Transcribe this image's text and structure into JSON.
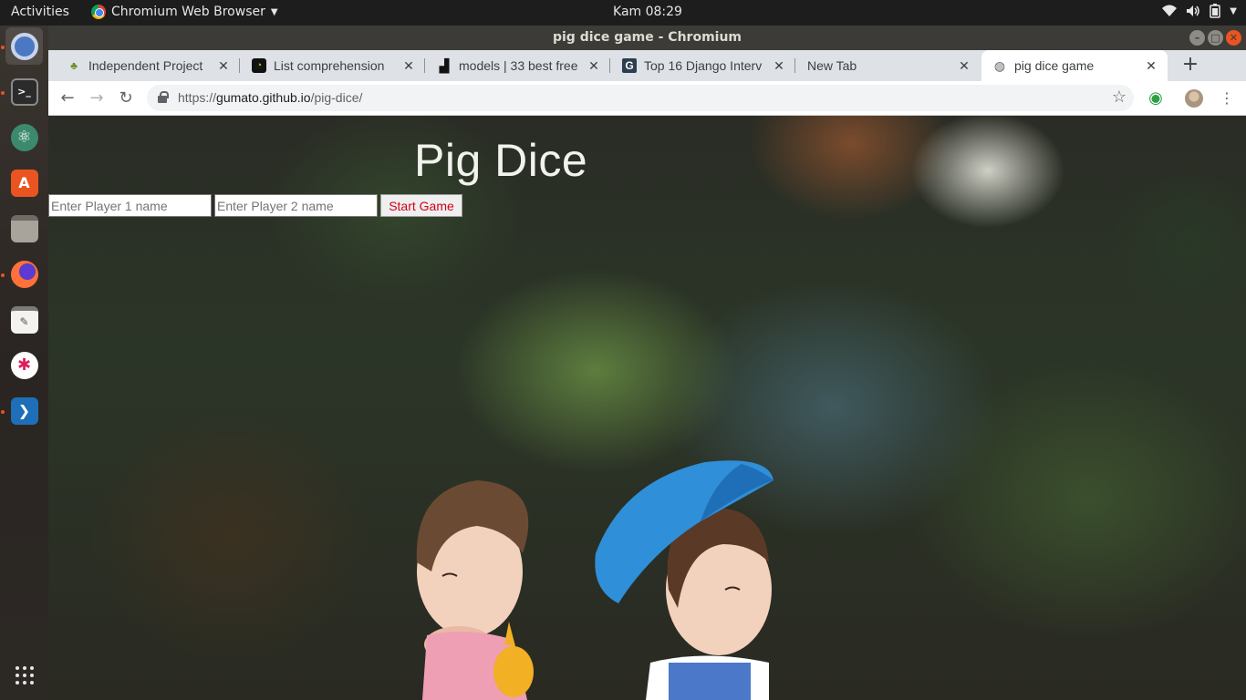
{
  "topbar": {
    "activities": "Activities",
    "app_name": "Chromium Web Browser",
    "clock": "Kam 08:29",
    "tray_icons": [
      "wifi-icon",
      "volume-icon",
      "battery-icon",
      "menu-caret-icon"
    ]
  },
  "dock": {
    "items": [
      {
        "name": "chromium",
        "icon": "chromium-icon",
        "active": true
      },
      {
        "name": "terminal",
        "icon": "terminal-icon"
      },
      {
        "name": "atom",
        "icon": "atom-icon"
      },
      {
        "name": "software",
        "icon": "software-center-icon"
      },
      {
        "name": "files",
        "icon": "files-icon"
      },
      {
        "name": "firefox",
        "icon": "firefox-icon"
      },
      {
        "name": "text-editor",
        "icon": "text-editor-icon"
      },
      {
        "name": "slack",
        "icon": "slack-icon"
      },
      {
        "name": "vscode",
        "icon": "vscode-icon"
      },
      {
        "name": "show-apps",
        "icon": "app-grid-icon"
      }
    ]
  },
  "window": {
    "title": "pig dice game - Chromium"
  },
  "tabs": [
    {
      "title": "Independent Project",
      "icon": "plant-icon"
    },
    {
      "title": "List comprehension",
      "icon": "clock-icon"
    },
    {
      "title": "models | 33 best free",
      "icon": "unsplash-icon"
    },
    {
      "title": "Top 16 Django Interv",
      "icon": "g-icon"
    },
    {
      "title": "New Tab",
      "icon": ""
    },
    {
      "title": "pig dice game",
      "icon": "globe-icon",
      "active": true
    }
  ],
  "toolbar": {
    "url_prefix": "https://",
    "url_host": "gumato.github.io",
    "url_path": "/pig-dice/"
  },
  "page": {
    "title": "Pig Dice",
    "player1_placeholder": "Enter Player 1 name",
    "player2_placeholder": "Enter Player 2 name",
    "start_button": "Start Game"
  },
  "colors": {
    "accent": "#e95420",
    "start_button_text": "#d0021b"
  }
}
